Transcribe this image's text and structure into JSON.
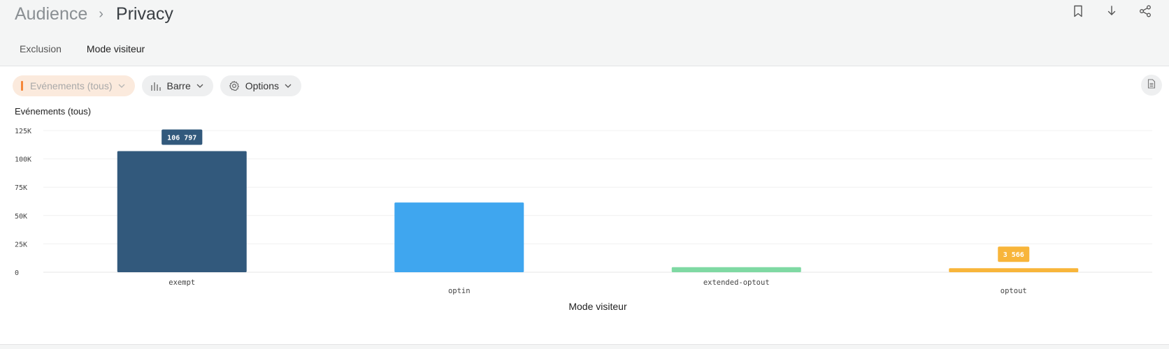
{
  "header": {
    "breadcrumb": {
      "root": "Audience",
      "separator": "›",
      "current": "Privacy"
    },
    "icons": [
      "bookmark-icon",
      "download-icon",
      "share-icon"
    ]
  },
  "tabs": [
    {
      "label": "Exclusion",
      "active": false
    },
    {
      "label": "Mode visiteur",
      "active": true
    }
  ],
  "toolbar": {
    "metric_label": "Evénements (tous)",
    "chart_type_label": "Barre",
    "options_label": "Options"
  },
  "chart_data": {
    "type": "bar",
    "title": "Evénements (tous)",
    "xlabel": "Mode visiteur",
    "ylabel": "",
    "categories": [
      "exempt",
      "optin",
      "extended-optout",
      "optout"
    ],
    "values": [
      106797,
      61500,
      4500,
      3566
    ],
    "colors": [
      "#32597c",
      "#3fa6ef",
      "#7fd9a3",
      "#f8b53a"
    ],
    "ylim": [
      0,
      125000
    ],
    "yticks": [
      {
        "value": 0,
        "label": "0"
      },
      {
        "value": 25000,
        "label": "25K"
      },
      {
        "value": 50000,
        "label": "50K"
      },
      {
        "value": 75000,
        "label": "75K"
      },
      {
        "value": 100000,
        "label": "100K"
      },
      {
        "value": 125000,
        "label": "125K"
      }
    ],
    "data_labels": [
      {
        "category": "exempt",
        "text": "106 797"
      },
      {
        "category": "optout",
        "text": "3 566"
      }
    ],
    "grid": true,
    "legend": "none"
  }
}
